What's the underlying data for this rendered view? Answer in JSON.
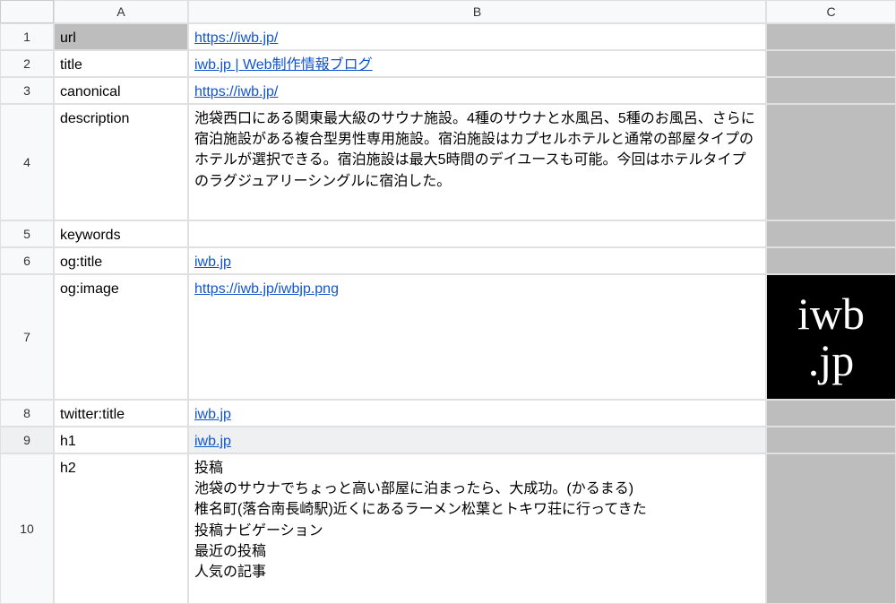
{
  "columns": [
    "A",
    "B",
    "C"
  ],
  "rows": [
    {
      "num": "1",
      "label": "url",
      "value": "https://iwb.jp/",
      "link": true,
      "selected": true
    },
    {
      "num": "2",
      "label": "title",
      "value": "iwb.jp | Web制作情報ブログ",
      "link": true
    },
    {
      "num": "3",
      "label": "canonical",
      "value": "https://iwb.jp/",
      "link": true
    },
    {
      "num": "4",
      "label": "description",
      "value": "池袋西口にある関東最大級のサウナ施設。4種のサウナと水風呂、5種のお風呂、さらに宿泊施設がある複合型男性専用施設。宿泊施設はカプセルホテルと通常の部屋タイプのホテルが選択できる。宿泊施設は最大5時間のデイユースも可能。今回はホテルタイプのラグジュアリーシングルに宿泊した。",
      "link": false
    },
    {
      "num": "5",
      "label": "keywords",
      "value": "",
      "link": false
    },
    {
      "num": "6",
      "label": "og:title",
      "value": "iwb.jp",
      "link": true
    },
    {
      "num": "7",
      "label": "og:image",
      "value": "https://iwb.jp/iwbjp.png",
      "link": true,
      "imageText": "iwb\n.jp"
    },
    {
      "num": "8",
      "label": "twitter:title",
      "value": "iwb.jp",
      "link": true
    },
    {
      "num": "9",
      "label": "h1",
      "value": "iwb.jp",
      "link": true,
      "highlight": true
    },
    {
      "num": "10",
      "label": "h2",
      "value": "投稿\n池袋のサウナでちょっと高い部屋に泊まったら、大成功。(かるまる)\n椎名町(落合南長崎駅)近くにあるラーメン松葉とトキワ荘に行ってきた\n投稿ナビゲーション\n最近の投稿\n人気の記事",
      "link": false
    }
  ],
  "rowHeights": [
    "30px",
    "30px",
    "30px",
    "130px",
    "30px",
    "30px",
    "140px",
    "30px",
    "30px",
    "168px"
  ]
}
